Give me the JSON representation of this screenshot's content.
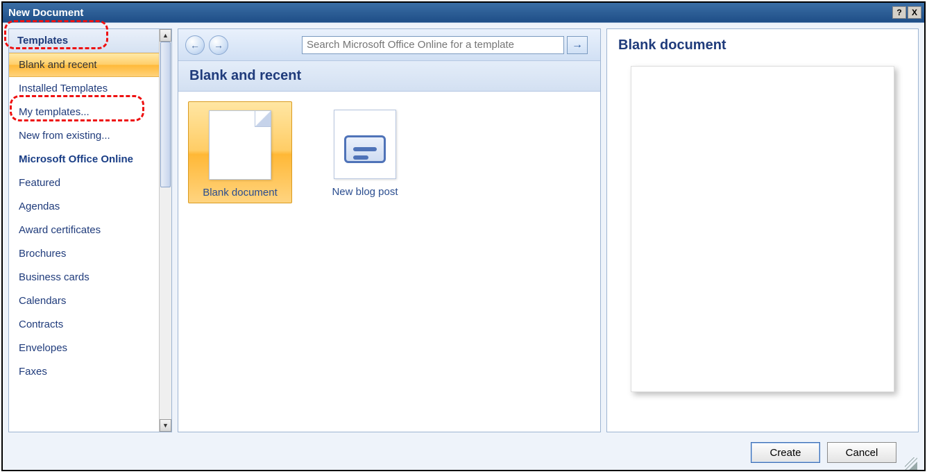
{
  "window": {
    "title": "New Document",
    "help_label": "?",
    "close_label": "X"
  },
  "sidebar": {
    "header": "Templates",
    "items": [
      {
        "label": "Blank and recent",
        "selected": true
      },
      {
        "label": "Installed Templates"
      },
      {
        "label": "My templates..."
      },
      {
        "label": "New from existing..."
      },
      {
        "label": "Microsoft Office Online",
        "bold": true
      },
      {
        "label": "Featured"
      },
      {
        "label": "Agendas"
      },
      {
        "label": "Award certificates"
      },
      {
        "label": "Brochures"
      },
      {
        "label": "Business cards"
      },
      {
        "label": "Calendars"
      },
      {
        "label": "Contracts"
      },
      {
        "label": "Envelopes"
      },
      {
        "label": "Faxes"
      }
    ]
  },
  "toolbar": {
    "back_glyph": "←",
    "forward_glyph": "→",
    "search_placeholder": "Search Microsoft Office Online for a template",
    "go_glyph": "→"
  },
  "main": {
    "section_title": "Blank and recent",
    "templates": [
      {
        "label": "Blank document",
        "kind": "doc",
        "selected": true
      },
      {
        "label": "New blog post",
        "kind": "blog"
      }
    ]
  },
  "preview": {
    "title": "Blank document"
  },
  "footer": {
    "create_label": "Create",
    "cancel_label": "Cancel"
  },
  "scrollbar": {
    "up_glyph": "▲",
    "down_glyph": "▼"
  }
}
